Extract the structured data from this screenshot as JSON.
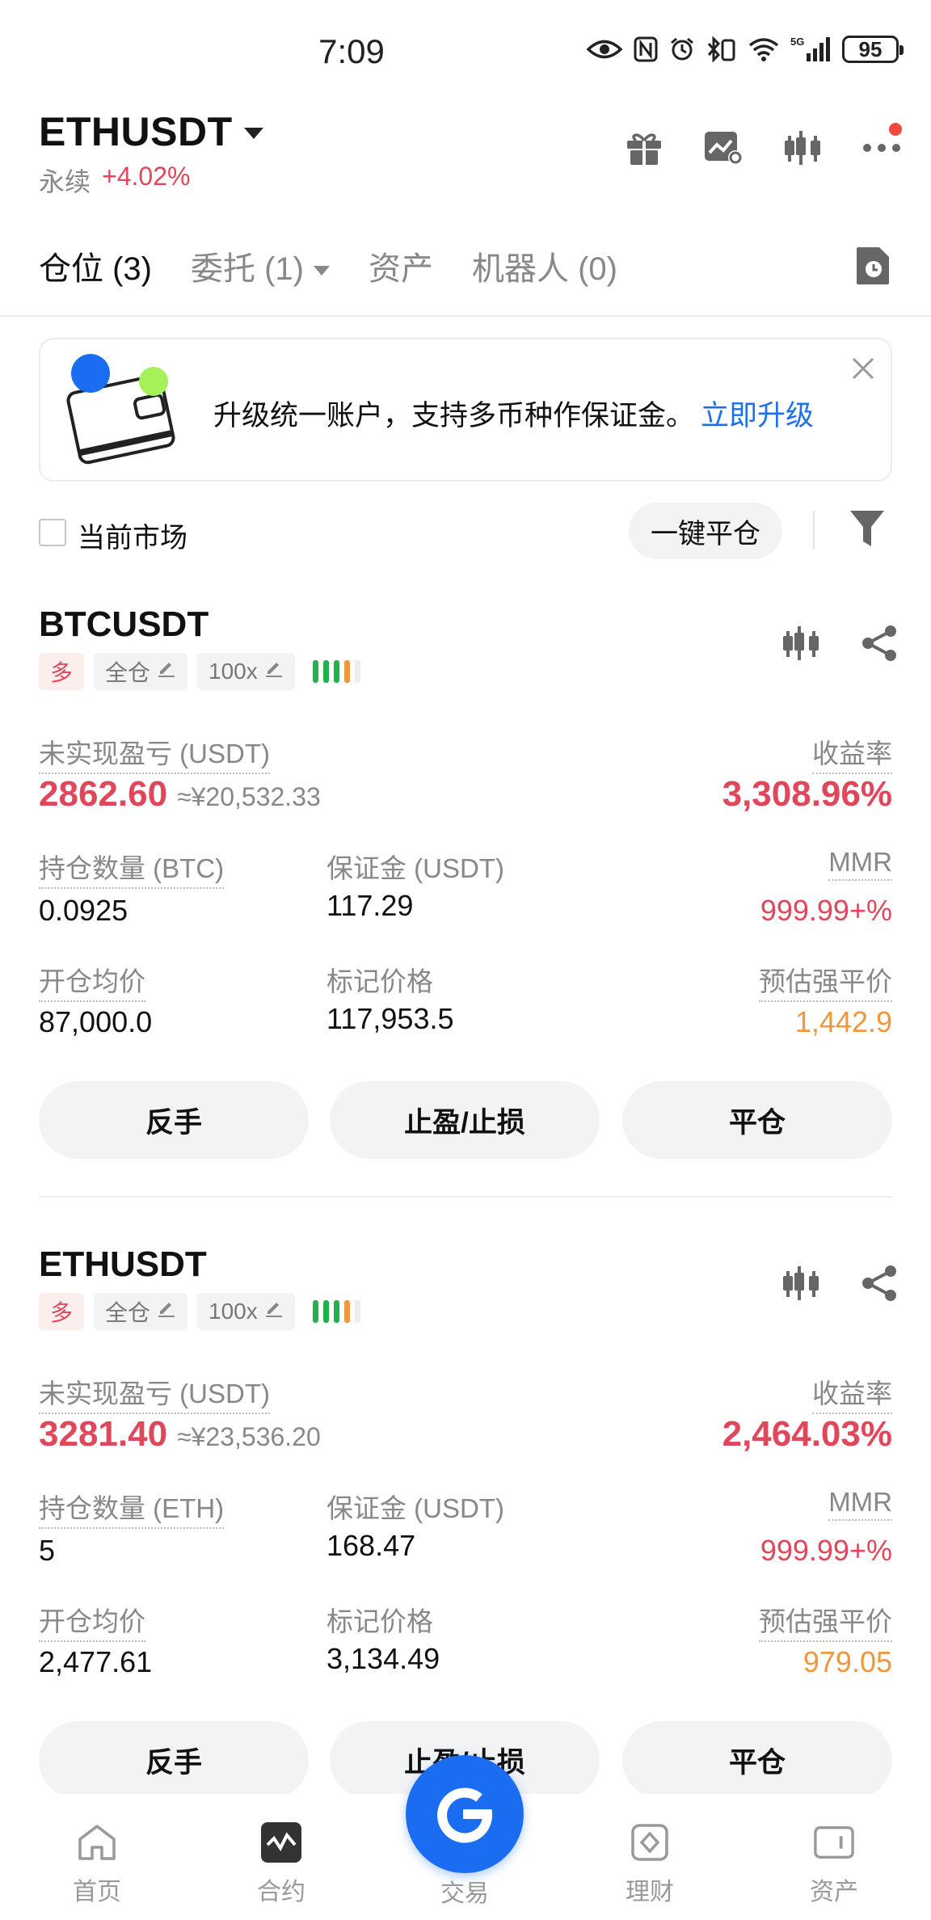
{
  "status_bar": {
    "time": "7:09",
    "network": "5G",
    "battery": "95"
  },
  "header": {
    "pair": "ETHUSDT",
    "type": "永续",
    "change": "+4.02%"
  },
  "tabs": [
    {
      "label": "仓位 (3)"
    },
    {
      "label": "委托 (1)"
    },
    {
      "label": "资产"
    },
    {
      "label": "机器人 (0)"
    }
  ],
  "banner": {
    "text": "升级统一账户，支持多币种作保证金。",
    "link": "立即升级"
  },
  "filters": {
    "current_market": "当前市场",
    "close_all": "一键平仓"
  },
  "positions": [
    {
      "symbol": "BTCUSDT",
      "side": "多",
      "margin_mode": "全仓",
      "leverage": "100x",
      "unrealized_pnl_label": "未实现盈亏 (USDT)",
      "unrealized_pnl": "2862.60",
      "unrealized_pnl_cny": "≈¥20,532.33",
      "roe_label": "收益率",
      "roe": "3,308.96%",
      "qty_label": "持仓数量 (BTC)",
      "qty": "0.0925",
      "margin_label": "保证金 (USDT)",
      "margin": "117.29",
      "mmr_label": "MMR",
      "mmr": "999.99+%",
      "entry_label": "开仓均价",
      "entry": "87,000.0",
      "mark_label": "标记价格",
      "mark": "117,953.5",
      "liq_label": "预估强平价",
      "liq": "1,442.9",
      "buttons": {
        "reverse": "反手",
        "tpsl": "止盈/止损",
        "close": "平仓"
      }
    },
    {
      "symbol": "ETHUSDT",
      "side": "多",
      "margin_mode": "全仓",
      "leverage": "100x",
      "unrealized_pnl_label": "未实现盈亏 (USDT)",
      "unrealized_pnl": "3281.40",
      "unrealized_pnl_cny": "≈¥23,536.20",
      "roe_label": "收益率",
      "roe": "2,464.03%",
      "qty_label": "持仓数量 (ETH)",
      "qty": "5",
      "margin_label": "保证金 (USDT)",
      "margin": "168.47",
      "mmr_label": "MMR",
      "mmr": "999.99+%",
      "entry_label": "开仓均价",
      "entry": "2,477.61",
      "mark_label": "标记价格",
      "mark": "3,134.49",
      "liq_label": "预估强平价",
      "liq": "979.05",
      "buttons": {
        "reverse": "反手",
        "tpsl": "止盈/止损",
        "close": "平仓"
      }
    }
  ],
  "risk_bar_colors": [
    "#22b24c",
    "#22b24c",
    "#22b24c",
    "#f0963c",
    "#eeeeee"
  ],
  "bottom_nav": [
    {
      "label": "首页",
      "icon": "home-icon"
    },
    {
      "label": "合约",
      "icon": "futures-icon"
    },
    {
      "label": "交易",
      "icon": "trade-icon"
    },
    {
      "label": "理财",
      "icon": "earn-icon"
    },
    {
      "label": "资产",
      "icon": "assets-icon"
    }
  ],
  "colors": {
    "up": "#e0475a",
    "accent": "#1a6cf0",
    "warning": "#f0963c"
  }
}
